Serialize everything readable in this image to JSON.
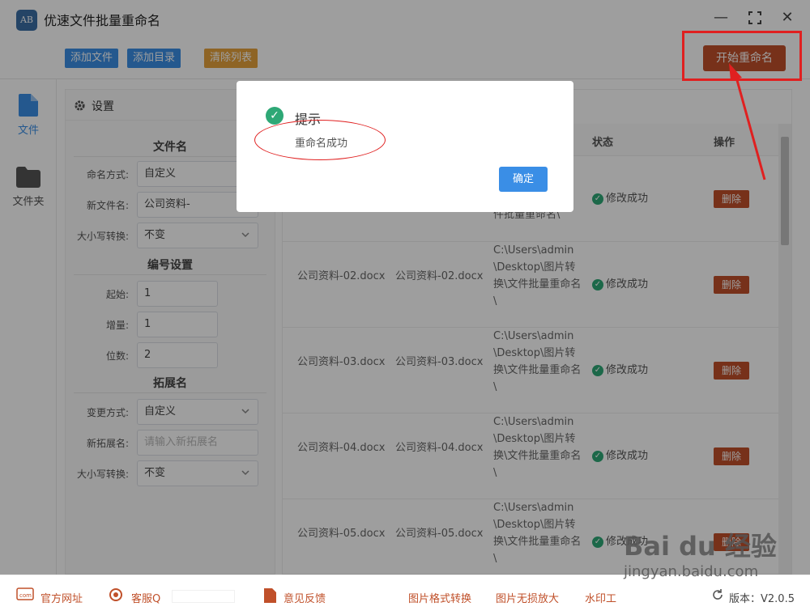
{
  "app": {
    "title": "优速文件批量重命名",
    "logo_text": "AB"
  },
  "toolbar": {
    "add_file": "添加文件",
    "add_dir": "添加目录",
    "clear_list": "清除列表",
    "start": "开始重命名"
  },
  "leftnav": {
    "items": [
      {
        "label": "文件",
        "icon": "file-icon",
        "active": true
      },
      {
        "label": "文件夹",
        "icon": "folder-icon",
        "active": false
      }
    ]
  },
  "settings": {
    "title": "设置",
    "filename_section": "文件名",
    "naming_mode_label": "命名方式:",
    "naming_mode_value": "自定义",
    "new_name_label": "新文件名:",
    "new_name_value": "公司资料-",
    "case_label": "大小写转换:",
    "case_value": "不变",
    "number_section": "编号设置",
    "start_label": "起始:",
    "start_value": "1",
    "increment_label": "增量:",
    "increment_value": "1",
    "digits_label": "位数:",
    "digits_value": "2",
    "ext_section": "拓展名",
    "ext_mode_label": "变更方式:",
    "ext_mode_value": "自定义",
    "new_ext_label": "新拓展名:",
    "new_ext_placeholder": "请输入新拓展名",
    "ext_case_label": "大小写转换:",
    "ext_case_value": "不变"
  },
  "table": {
    "headers": {
      "status": "状态",
      "action": "操作"
    },
    "rows": [
      {
        "orig": "",
        "new": "",
        "path": "件批量重命名\\",
        "status": "修改成功",
        "action": "删除"
      },
      {
        "orig": "公司资料-02.docx",
        "new": "公司资料-02.docx",
        "path": "C:\\Users\\admin\\Desktop\\图片转换\\文件批量重命名\\",
        "status": "修改成功",
        "action": "删除"
      },
      {
        "orig": "公司资料-03.docx",
        "new": "公司资料-03.docx",
        "path": "C:\\Users\\admin\\Desktop\\图片转换\\文件批量重命名\\",
        "status": "修改成功",
        "action": "删除"
      },
      {
        "orig": "公司资料-04.docx",
        "new": "公司资料-04.docx",
        "path": "C:\\Users\\admin\\Desktop\\图片转换\\文件批量重命名\\",
        "status": "修改成功",
        "action": "删除"
      },
      {
        "orig": "公司资料-05.docx",
        "new": "公司资料-05.docx",
        "path": "C:\\Users\\admin\\Desktop\\图片转换\\文件批量重命名\\",
        "status": "修改成功",
        "action": "删除"
      }
    ]
  },
  "dialog": {
    "title": "提示",
    "message": "重命名成功",
    "ok": "确定"
  },
  "bottom": {
    "website": "官方网址",
    "service": "客服Q",
    "feedback": "意见反馈",
    "img_convert": "图片格式转换",
    "img_enlarge": "图片无损放大",
    "watermark": "水印工",
    "version": "版本：V2.0.5"
  },
  "watermark": {
    "brand": "Bai du 经验",
    "url": "jingyan.baidu.com"
  },
  "colors": {
    "primary": "#3a8ee6",
    "warning": "#e6a23c",
    "danger": "#c0502a",
    "success": "#2ea876",
    "annotation": "#e02020"
  }
}
